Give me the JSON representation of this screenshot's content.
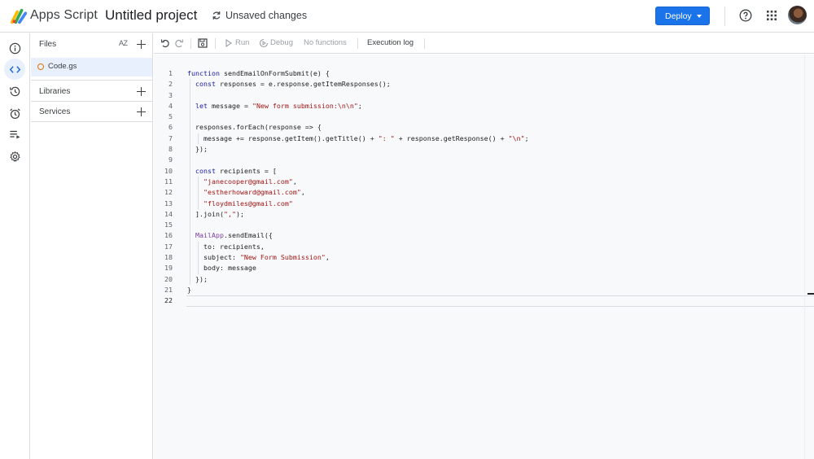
{
  "header": {
    "app_name": "Apps Script",
    "project_name": "Untitled project",
    "status": "Unsaved changes",
    "deploy_label": "Deploy",
    "colors": {
      "deploy": "#1a73e8",
      "active_bg": "#e8f0fe"
    }
  },
  "rail": {
    "items": [
      {
        "name": "overview-icon"
      },
      {
        "name": "editor-icon",
        "active": true
      },
      {
        "name": "history-icon"
      },
      {
        "name": "triggers-icon"
      },
      {
        "name": "executions-icon"
      },
      {
        "name": "settings-icon"
      }
    ]
  },
  "files_panel": {
    "files_title": "Files",
    "sort_label": "AZ",
    "file": "Code.gs",
    "libraries_title": "Libraries",
    "services_title": "Services"
  },
  "toolbar": {
    "run": "Run",
    "debug": "Debug",
    "function_select": "No functions",
    "execution_log": "Execution log"
  },
  "editor": {
    "lines": [
      "1",
      "2",
      "3",
      "4",
      "5",
      "6",
      "7",
      "8",
      "9",
      "10",
      "11",
      "12",
      "13",
      "14",
      "15",
      "16",
      "17",
      "18",
      "19",
      "20",
      "21",
      "22"
    ],
    "code": [
      "function sendEmailOnFormSubmit(e) {",
      "  const responses = e.response.getItemResponses();",
      "",
      "  let message = \"New form submission:\\n\\n\";",
      "",
      "  responses.forEach(response => {",
      "    message += response.getItem().getTitle() + \": \" + response.getResponse() + \"\\n\";",
      "  });",
      "",
      "  const recipients = [",
      "    \"janecooper@gmail.com\",",
      "    \"estherhoward@gmail.com\",",
      "    \"floydmiles@gmail.com\"",
      "  ].join(\",\");",
      "",
      "  MailApp.sendEmail({",
      "    to: recipients,",
      "    subject: \"New Form Submission\",",
      "    body: message",
      "  });",
      "}",
      ""
    ]
  }
}
